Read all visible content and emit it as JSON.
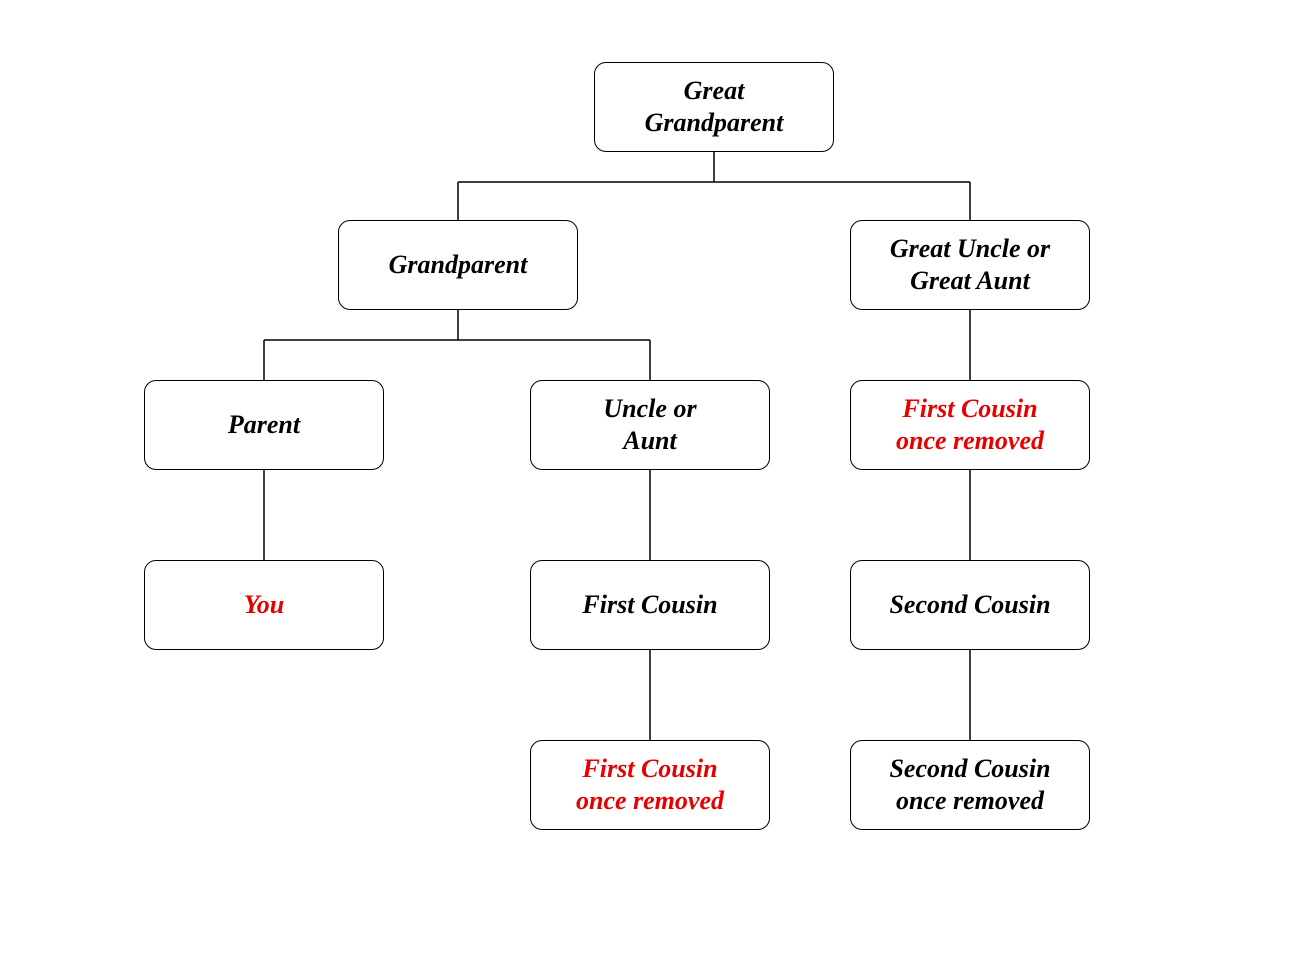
{
  "colors": {
    "highlight": "#e60000",
    "border": "#000000",
    "background": "#ffffff"
  },
  "nodes": {
    "great_grandparent": {
      "label": "Great\nGrandparent",
      "highlight": false
    },
    "grandparent": {
      "label": "Grandparent",
      "highlight": false
    },
    "great_uncle_aunt": {
      "label": "Great Uncle or\nGreat Aunt",
      "highlight": false
    },
    "parent": {
      "label": "Parent",
      "highlight": false
    },
    "uncle_aunt": {
      "label": "Uncle or\nAunt",
      "highlight": false
    },
    "first_cousin_once_removed_upper": {
      "label": "First Cousin\nonce removed",
      "highlight": true
    },
    "you": {
      "label": "You",
      "highlight": true
    },
    "first_cousin": {
      "label": "First Cousin",
      "highlight": false
    },
    "second_cousin": {
      "label": "Second Cousin",
      "highlight": false
    },
    "first_cousin_once_removed_lower": {
      "label": "First Cousin\nonce removed",
      "highlight": true
    },
    "second_cousin_once_removed": {
      "label": "Second Cousin\nonce removed",
      "highlight": false
    }
  },
  "edges": [
    {
      "from": "great_grandparent",
      "to_children": [
        "grandparent",
        "great_uncle_aunt"
      ]
    },
    {
      "from": "grandparent",
      "to_children": [
        "parent",
        "uncle_aunt"
      ]
    },
    {
      "from": "great_uncle_aunt",
      "to_children": [
        "first_cousin_once_removed_upper"
      ]
    },
    {
      "from": "parent",
      "to_children": [
        "you"
      ]
    },
    {
      "from": "uncle_aunt",
      "to_children": [
        "first_cousin"
      ]
    },
    {
      "from": "first_cousin_once_removed_upper",
      "to_children": [
        "second_cousin"
      ]
    },
    {
      "from": "first_cousin",
      "to_children": [
        "first_cousin_once_removed_lower"
      ]
    },
    {
      "from": "second_cousin",
      "to_children": [
        "second_cousin_once_removed"
      ]
    }
  ]
}
